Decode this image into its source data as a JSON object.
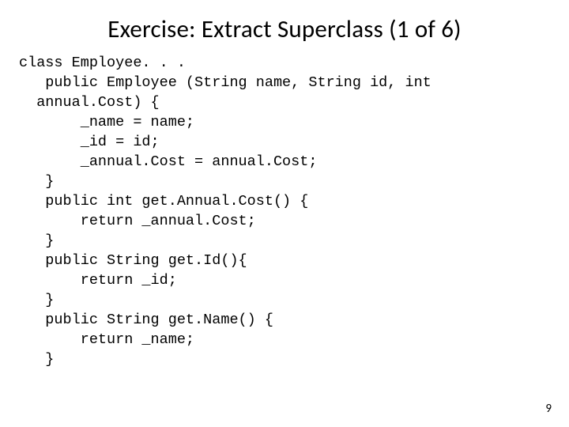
{
  "title": "Exercise: Extract Superclass (1 of 6)",
  "code": "class Employee. . .\n   public Employee (String name, String id, int\n  annual.Cost) {\n       _name = name;\n       _id = id;\n       _annual.Cost = annual.Cost;\n   }\n   public int get.Annual.Cost() {\n       return _annual.Cost;\n   }\n   public String get.Id(){\n       return _id;\n   }\n   public String get.Name() {\n       return _name;\n   }",
  "pageNumber": "9"
}
